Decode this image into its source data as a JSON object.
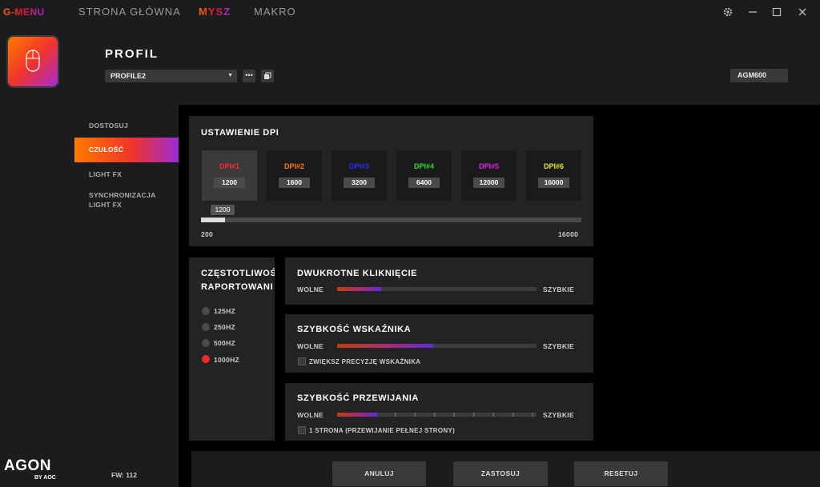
{
  "app": {
    "brand": "G-MENU"
  },
  "nav": {
    "tabs": [
      {
        "label": "STRONA GŁÓWNA"
      },
      {
        "label": "MYSZ"
      },
      {
        "label": "MAKRO"
      }
    ],
    "active": "MYSZ"
  },
  "window_controls": {
    "settings_icon": "gear-icon",
    "minimize_icon": "minimize-icon",
    "maximize_icon": "maximize-icon",
    "close_icon": "close-icon"
  },
  "branding": {
    "agon": "AGON",
    "by": "BY AOC"
  },
  "header": {
    "title": "PROFIL",
    "profile_select": "PROFILE2",
    "model": "AGM600",
    "more_icon": "more-icon",
    "copy_icon": "copy-icon"
  },
  "sidebar": {
    "items": [
      {
        "label": "DOSTOSUJ"
      },
      {
        "label": "CZUŁOŚĆ"
      },
      {
        "label": "LIGHT FX"
      },
      {
        "label": "SYNCHRONIZACJA LIGHT FX"
      }
    ],
    "active": "CZUŁOŚĆ",
    "fw": "FW: 112"
  },
  "dpi": {
    "title": "USTAWIENIE DPI",
    "stages": [
      {
        "label": "DPI#1",
        "value": "1200",
        "color": "#ff2a2a"
      },
      {
        "label": "DPI#2",
        "value": "1600",
        "color": "#ff7a00"
      },
      {
        "label": "DPI#3",
        "value": "3200",
        "color": "#2a2aff"
      },
      {
        "label": "DPI#4",
        "value": "6400",
        "color": "#22dd22"
      },
      {
        "label": "DPI#5",
        "value": "12000",
        "color": "#e020e0"
      },
      {
        "label": "DPI#6",
        "value": "16000",
        "color": "#e8e800"
      }
    ],
    "selected_index": 0,
    "slider": {
      "tooltip": "1200",
      "value": 1200,
      "min": 200,
      "max": 16000,
      "min_label": "200",
      "max_label": "16000"
    }
  },
  "report_rate": {
    "title_line1": "CZĘSTOTLIWOŚ",
    "title_line2": "RAPORTOWANI",
    "options": [
      {
        "label": "125HZ",
        "selected": false
      },
      {
        "label": "250HZ",
        "selected": false
      },
      {
        "label": "500HZ",
        "selected": false
      },
      {
        "label": "1000HZ",
        "selected": true
      }
    ]
  },
  "double_click": {
    "title": "DWUKROTNE KLIKNIĘCIE",
    "slow": "WOLNE",
    "fast": "SZYBKIE",
    "level": 0.22
  },
  "pointer_speed": {
    "title": "SZYBKOŚĆ WSKAŹNIKA",
    "slow": "WOLNE",
    "fast": "SZYBKIE",
    "level": 0.48,
    "checkbox": "ZWIĘKSZ PRECYZJĘ WSKAŹNIKA",
    "checked": false
  },
  "scroll_speed": {
    "title": "SZYBKOŚĆ PRZEWIJANIA",
    "slow": "WOLNE",
    "fast": "SZYBKIE",
    "level": 0.2,
    "checkbox": "1 STRONA (PRZEWIJANIE PEŁNEJ STRONY)",
    "checked": false
  },
  "actions": {
    "cancel": "ANULUJ",
    "apply": "ZASTOSUJ",
    "reset": "RESETUJ"
  }
}
